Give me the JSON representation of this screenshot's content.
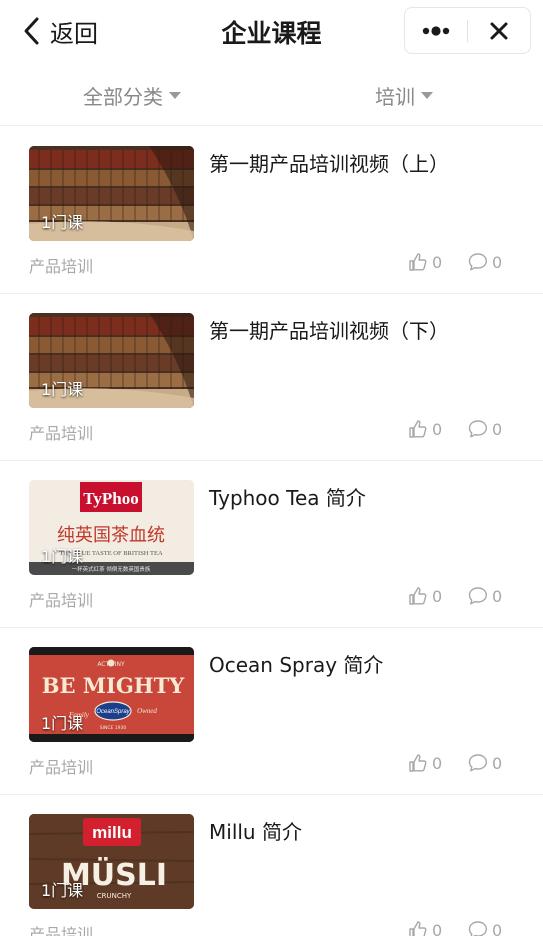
{
  "navbar": {
    "back_label": "返回",
    "title": "企业课程"
  },
  "filters": {
    "category": "全部分类",
    "type": "培训"
  },
  "courses": [
    {
      "title": "第一期产品培训视频（上）",
      "category": "产品培训",
      "lesson_count": "1门课",
      "likes": "0",
      "comments": "0",
      "thumbnail": "library-bookshelf"
    },
    {
      "title": "第一期产品培训视频（下）",
      "category": "产品培训",
      "lesson_count": "1门课",
      "likes": "0",
      "comments": "0",
      "thumbnail": "library-bookshelf"
    },
    {
      "title": "Typhoo Tea 简介",
      "category": "产品培训",
      "lesson_count": "1门课",
      "likes": "0",
      "comments": "0",
      "thumbnail": "typhoo-tea",
      "thumb_text": {
        "logo": "TyPhoo",
        "headline": "纯英国茶血统",
        "tagline": "THE TRUE TASTE OF BRITISH TEA",
        "subline": "一杯英式红茶 倾倒无数英国贵族"
      }
    },
    {
      "title": "Ocean Spray 简介",
      "category": "产品培训",
      "lesson_count": "1门课",
      "likes": "0",
      "comments": "0",
      "thumbnail": "ocean-spray",
      "thumb_text": {
        "top": "ACT TINY",
        "headline": "BE MIGHTY",
        "left_script": "Family",
        "logo": "OceanSpray",
        "right_script": "Owned",
        "sub": "SINCE 1930"
      }
    },
    {
      "title": "Millu 简介",
      "category": "产品培训",
      "lesson_count": "1门课",
      "likes": "0",
      "comments": "0",
      "thumbnail": "millu-musli",
      "thumb_text": {
        "logo": "millu",
        "headline": "MÜSLI",
        "sub": "CRUNCHY"
      }
    }
  ],
  "icons": {
    "back": "chevron-left-icon",
    "more": "more-dots-icon",
    "close": "close-icon",
    "filter_caret": "caret-down-icon",
    "like": "thumbs-up-icon",
    "comment": "comment-bubble-icon"
  },
  "colors": {
    "text_primary": "#1a1a1a",
    "text_secondary": "#a8a8a8",
    "filter_text": "#888888",
    "divider": "#eeeeee"
  }
}
